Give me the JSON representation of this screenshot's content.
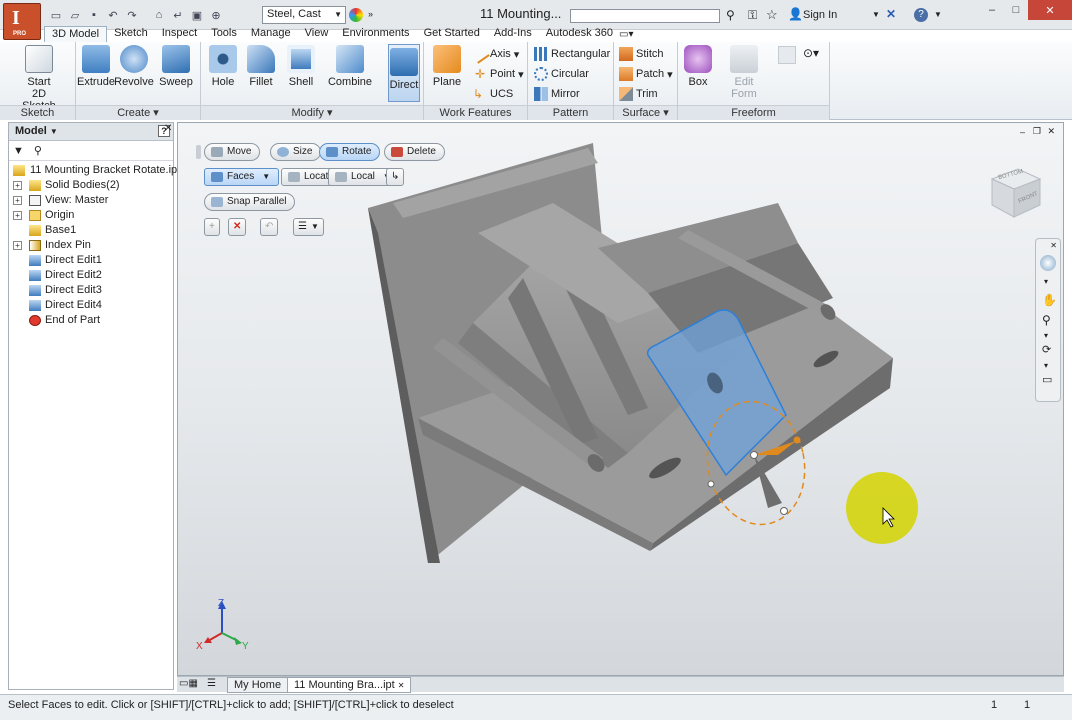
{
  "app": {
    "title": "11 Mounting...",
    "logo_letter": "I",
    "logo_badge": "PRO",
    "material": "Steel, Cast",
    "search_placeholder": "",
    "sign_in": "Sign In"
  },
  "tabs": [
    "3D Model",
    "Sketch",
    "Inspect",
    "Tools",
    "Manage",
    "View",
    "Environments",
    "Get Started",
    "Add-Ins",
    "Autodesk 360"
  ],
  "ribbon": {
    "sketch": {
      "label": "Sketch",
      "start": "Start",
      "start2": "2D Sketch"
    },
    "create": {
      "label": "Create",
      "extrude": "Extrude",
      "revolve": "Revolve",
      "sweep": "Sweep"
    },
    "modify": {
      "label": "Modify",
      "hole": "Hole",
      "fillet": "Fillet",
      "shell": "Shell",
      "combine": "Combine",
      "direct": "Direct"
    },
    "work": {
      "label": "Work Features",
      "plane": "Plane",
      "axis": "Axis",
      "point": "Point",
      "ucs": "UCS"
    },
    "pattern": {
      "label": "Pattern",
      "rect": "Rectangular",
      "circ": "Circular",
      "mirror": "Mirror"
    },
    "surface": {
      "label": "Surface",
      "stitch": "Stitch",
      "patch": "Patch",
      "trim": "Trim"
    },
    "freeform": {
      "label": "Freeform",
      "box": "Box",
      "edit": "Edit",
      "edit2": "Form"
    }
  },
  "browser": {
    "title": "Model",
    "nodes": [
      {
        "label": "11 Mounting Bracket Rotate.ipt"
      },
      {
        "label": "Solid Bodies(2)"
      },
      {
        "label": "View: Master"
      },
      {
        "label": "Origin"
      },
      {
        "label": "Base1"
      },
      {
        "label": "Index Pin"
      },
      {
        "label": "Direct Edit1"
      },
      {
        "label": "Direct Edit2"
      },
      {
        "label": "Direct Edit3"
      },
      {
        "label": "Direct Edit4"
      },
      {
        "label": "End of Part"
      }
    ]
  },
  "minitoolbar": {
    "move": "Move",
    "size": "Size",
    "rotate": "Rotate",
    "delete": "Delete",
    "faces": "Faces",
    "locate": "Locate",
    "local": "Local",
    "snap": "Snap Parallel"
  },
  "viewcube": {
    "front": "FRONT",
    "bottom": "BOTTOM"
  },
  "triad": {
    "x": "X",
    "y": "Y",
    "z": "Z"
  },
  "doctabs": {
    "home": "My Home",
    "doc": "11 Mounting Bra...ipt"
  },
  "status": {
    "text": "Select Faces to edit. Click or [SHIFT]/[CTRL]+click to add; [SHIFT]/[CTRL]+click to deselect",
    "n1": "1",
    "n2": "1"
  },
  "colors": {
    "accent": "#2f7fd6",
    "selection": "#5b9be6",
    "highlight": "#e08a1e",
    "cursor_halo": "#d4d400"
  }
}
